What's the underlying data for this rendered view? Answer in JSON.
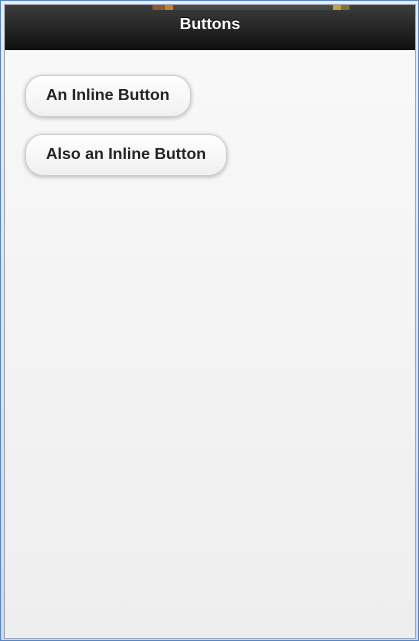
{
  "header": {
    "title": "Buttons"
  },
  "content": {
    "buttons": [
      {
        "label": "An Inline Button"
      },
      {
        "label": "Also an Inline Button"
      }
    ]
  }
}
